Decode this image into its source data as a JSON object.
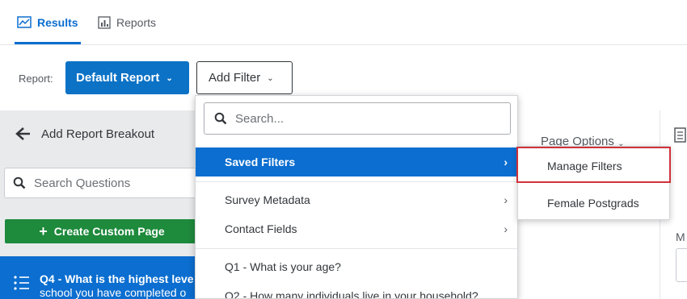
{
  "tabs": {
    "results_label": "Results",
    "reports_label": "Reports"
  },
  "report_bar": {
    "report_label": "Report:",
    "default_report_label": "Default Report",
    "add_filter_label": "Add Filter"
  },
  "left_panel": {
    "breakout_label": "Add Report Breakout",
    "search_placeholder": "Search Questions",
    "create_page_label": "Create Custom Page",
    "question_line1": "Q4 - What is the highest leve",
    "question_line2": "school you have completed o"
  },
  "right_panel": {
    "page_options_label": "Page Options",
    "partial_letter": "M"
  },
  "filter_dropdown": {
    "search_placeholder": "Search...",
    "items": [
      {
        "label": "Saved Filters",
        "has_submenu": true,
        "active": true
      },
      {
        "label": "Survey Metadata",
        "has_submenu": true,
        "active": false
      },
      {
        "label": "Contact Fields",
        "has_submenu": true,
        "active": false
      },
      {
        "label": "Q1 - What is your age?",
        "has_submenu": false,
        "active": false
      },
      {
        "label": "Q2 - How many individuals live in your household?",
        "has_submenu": false,
        "active": false
      }
    ]
  },
  "saved_filters_submenu": {
    "items": [
      {
        "label": "Manage Filters",
        "highlighted": true
      },
      {
        "label": "Female Postgrads",
        "highlighted": false
      }
    ],
    "highlight_color": "#d0323a"
  },
  "colors": {
    "accent": "#0b6ed0",
    "create_green": "#1e8a3c",
    "panel_gray": "#e9eaec"
  }
}
